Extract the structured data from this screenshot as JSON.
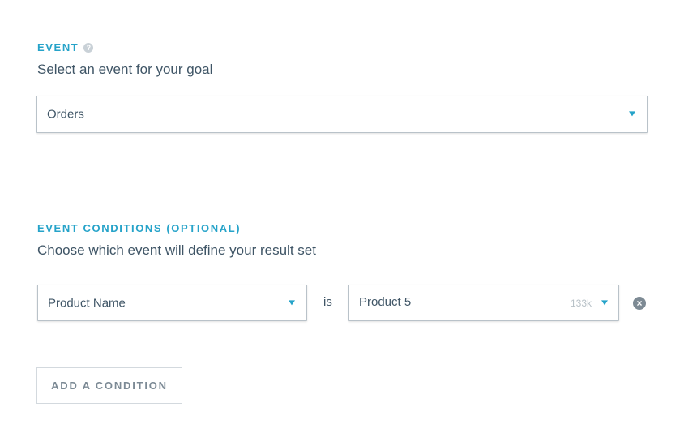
{
  "event_section": {
    "label": "EVENT",
    "help_icon": "?",
    "subtitle": "Select an event for your goal",
    "select_value": "Orders"
  },
  "conditions_section": {
    "label": "EVENT CONDITIONS (OPTIONAL)",
    "subtitle": "Choose which event will define your result set"
  },
  "condition": {
    "property_value": "Product Name",
    "operator": "is",
    "value": "Product 5",
    "value_count": "133k",
    "remove_icon": "×"
  },
  "add_condition_label": "ADD A CONDITION",
  "colors": {
    "accent": "#26a3c9",
    "text": "#3f5566",
    "muted": "#b8c1c7",
    "border": "#b9c2c9"
  },
  "icons": [
    "help-icon",
    "chevron-down-icon",
    "remove-circle-icon"
  ]
}
